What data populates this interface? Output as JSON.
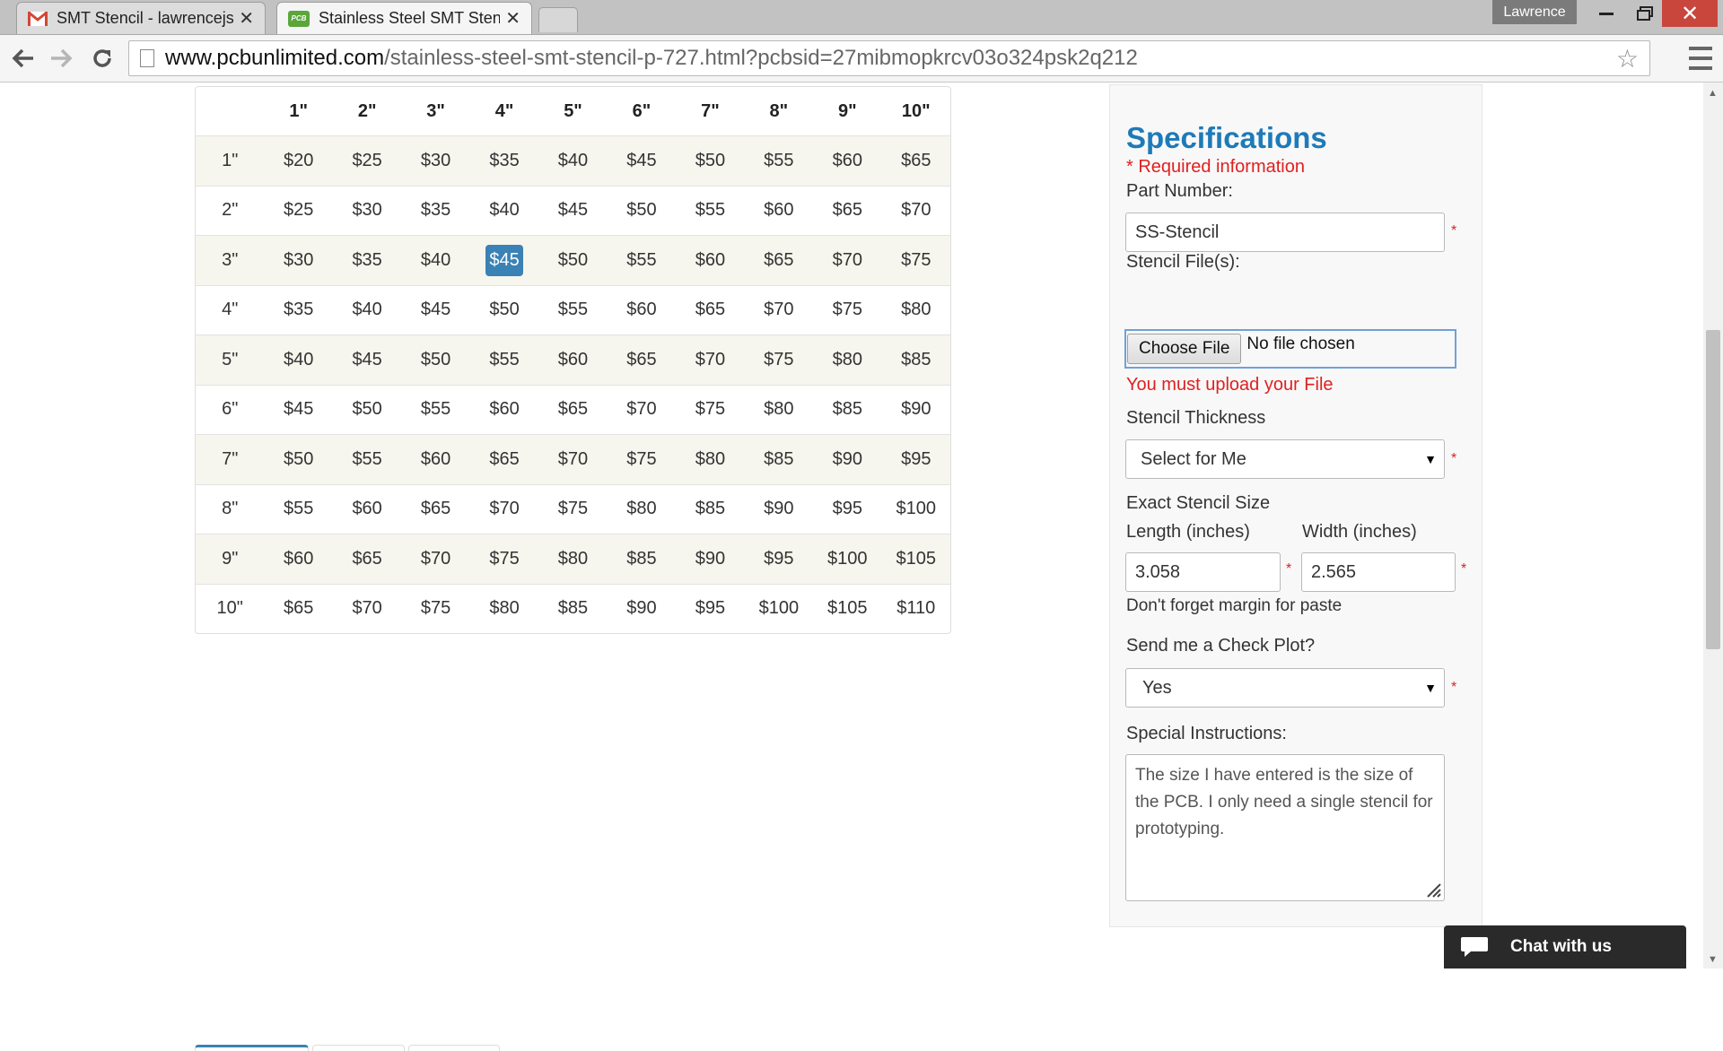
{
  "browser": {
    "tabs": [
      {
        "title": "SMT Stencil - lawrencejsw",
        "icon": "gmail-icon",
        "active": false
      },
      {
        "title": "Stainless Steel SMT Stenci",
        "icon": "pcb-icon",
        "active": true
      }
    ],
    "user_name": "Lawrence",
    "url_domain": "www.pcbunlimited.com",
    "url_path": "/stainless-steel-smt-stencil-p-727.html?pcbsid=27mibmopkrcv03o324psk2q212",
    "pcb_icon_text": "PCB"
  },
  "price_table": {
    "columns": [
      "1\"",
      "2\"",
      "3\"",
      "4\"",
      "5\"",
      "6\"",
      "7\"",
      "8\"",
      "9\"",
      "10\""
    ],
    "rows": [
      {
        "label": "1\"",
        "prices": [
          "$20",
          "$25",
          "$30",
          "$35",
          "$40",
          "$45",
          "$50",
          "$55",
          "$60",
          "$65"
        ]
      },
      {
        "label": "2\"",
        "prices": [
          "$25",
          "$30",
          "$35",
          "$40",
          "$45",
          "$50",
          "$55",
          "$60",
          "$65",
          "$70"
        ]
      },
      {
        "label": "3\"",
        "prices": [
          "$30",
          "$35",
          "$40",
          "$45",
          "$50",
          "$55",
          "$60",
          "$65",
          "$70",
          "$75"
        ]
      },
      {
        "label": "4\"",
        "prices": [
          "$35",
          "$40",
          "$45",
          "$50",
          "$55",
          "$60",
          "$65",
          "$70",
          "$75",
          "$80"
        ]
      },
      {
        "label": "5\"",
        "prices": [
          "$40",
          "$45",
          "$50",
          "$55",
          "$60",
          "$65",
          "$70",
          "$75",
          "$80",
          "$85"
        ]
      },
      {
        "label": "6\"",
        "prices": [
          "$45",
          "$50",
          "$55",
          "$60",
          "$65",
          "$70",
          "$75",
          "$80",
          "$85",
          "$90"
        ]
      },
      {
        "label": "7\"",
        "prices": [
          "$50",
          "$55",
          "$60",
          "$65",
          "$70",
          "$75",
          "$80",
          "$85",
          "$90",
          "$95"
        ]
      },
      {
        "label": "8\"",
        "prices": [
          "$55",
          "$60",
          "$65",
          "$70",
          "$75",
          "$80",
          "$85",
          "$90",
          "$95",
          "$100"
        ]
      },
      {
        "label": "9\"",
        "prices": [
          "$60",
          "$65",
          "$70",
          "$75",
          "$80",
          "$85",
          "$90",
          "$95",
          "$100",
          "$105"
        ]
      },
      {
        "label": "10\"",
        "prices": [
          "$65",
          "$70",
          "$75",
          "$80",
          "$85",
          "$90",
          "$95",
          "$100",
          "$105",
          "$110"
        ]
      }
    ],
    "selected": {
      "row": 2,
      "col": 3
    },
    "highlight_color": "#3a82b5"
  },
  "specifications": {
    "title": "Specifications",
    "required_note": "* Required information",
    "part_number_label": "Part Number:",
    "part_number_value": "SS-Stencil",
    "stencil_files_label": "Stencil File(s):",
    "choose_file_label": "Choose File",
    "no_file_text": "No file chosen",
    "upload_error": "You must upload your File",
    "thickness_label": "Stencil Thickness",
    "thickness_value": "Select for Me",
    "size_label": "Exact Stencil Size",
    "length_label": "Length (inches)",
    "length_value": "3.058",
    "width_label": "Width (inches)",
    "width_value": "2.565",
    "margin_note": "Don't forget margin for paste",
    "check_plot_label": "Send me a Check Plot?",
    "check_plot_value": "Yes",
    "instructions_label": "Special Instructions:",
    "instructions_value": "The size I have entered is the size of the PCB. I only need a single stencil for prototyping.",
    "required_star": "*",
    "title_color": "#1e7ab8",
    "error_color": "#e02020"
  },
  "chat": {
    "label": "Chat with us"
  }
}
